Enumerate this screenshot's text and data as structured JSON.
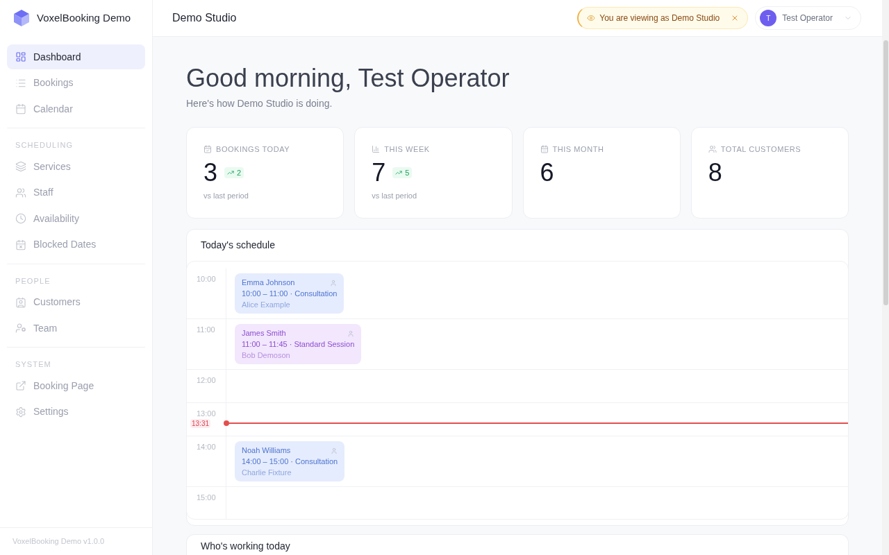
{
  "sidebar": {
    "brand": "VoxelBooking Demo",
    "sections": [
      {
        "items": [
          {
            "label": "Dashboard",
            "selected": true
          },
          {
            "label": "Bookings",
            "selected": false
          },
          {
            "label": "Calendar",
            "selected": false
          }
        ]
      },
      {
        "heading": "SCHEDULING",
        "items": [
          {
            "label": "Services",
            "selected": false
          },
          {
            "label": "Staff",
            "selected": false
          },
          {
            "label": "Availability",
            "selected": false
          },
          {
            "label": "Blocked Dates",
            "selected": false
          }
        ]
      },
      {
        "heading": "PEOPLE",
        "items": [
          {
            "label": "Customers",
            "selected": false
          },
          {
            "label": "Team",
            "selected": false
          }
        ]
      },
      {
        "heading": "SYSTEM",
        "items": [
          {
            "label": "Booking Page",
            "selected": false
          },
          {
            "label": "Settings",
            "selected": false
          }
        ]
      }
    ],
    "footer": "VoxelBooking Demo v1.0.0"
  },
  "header": {
    "title": "Demo Studio",
    "notice": {
      "text": "You are viewing as Demo Studio"
    },
    "user": {
      "initial": "T",
      "name": "Test Operator"
    }
  },
  "greeting": {
    "title": "Good morning, Test Operator",
    "subtitle": "Here's how Demo Studio is doing."
  },
  "stats": [
    {
      "label": "BOOKINGS TODAY",
      "value": "3",
      "change": "2",
      "note": "vs last period"
    },
    {
      "label": "THIS WEEK",
      "value": "7",
      "change": "5",
      "note": "vs last period"
    },
    {
      "label": "THIS MONTH",
      "value": "6"
    },
    {
      "label": "TOTAL CUSTOMERS",
      "value": "8"
    }
  ],
  "schedule": {
    "title": "Today's schedule",
    "slots": [
      {
        "time": "10:00",
        "bookings": [
          {
            "customer": "Emma Johnson",
            "details": "10:00 – 11:00 · Consultation",
            "staff": "Alice Example",
            "color": "#e5ecfd"
          }
        ]
      },
      {
        "time": "11:00",
        "bookings": [
          {
            "customer": "James Smith",
            "details": "11:00 – 11:45 · Standard Session",
            "staff": "Bob Demoson",
            "color": "#f2e7fd"
          }
        ]
      },
      {
        "time": "12:00"
      },
      {
        "time": "13:00",
        "now": "13:31"
      },
      {
        "time": "14:00",
        "bookings": [
          {
            "customer": "Noah Williams",
            "details": "14:00 – 15:00 · Consultation",
            "staff": "Charlie Fixture",
            "color": "#e5ecfd"
          }
        ]
      },
      {
        "time": "15:00"
      }
    ]
  },
  "staff_on_duty": {
    "title": "Who's working today"
  }
}
